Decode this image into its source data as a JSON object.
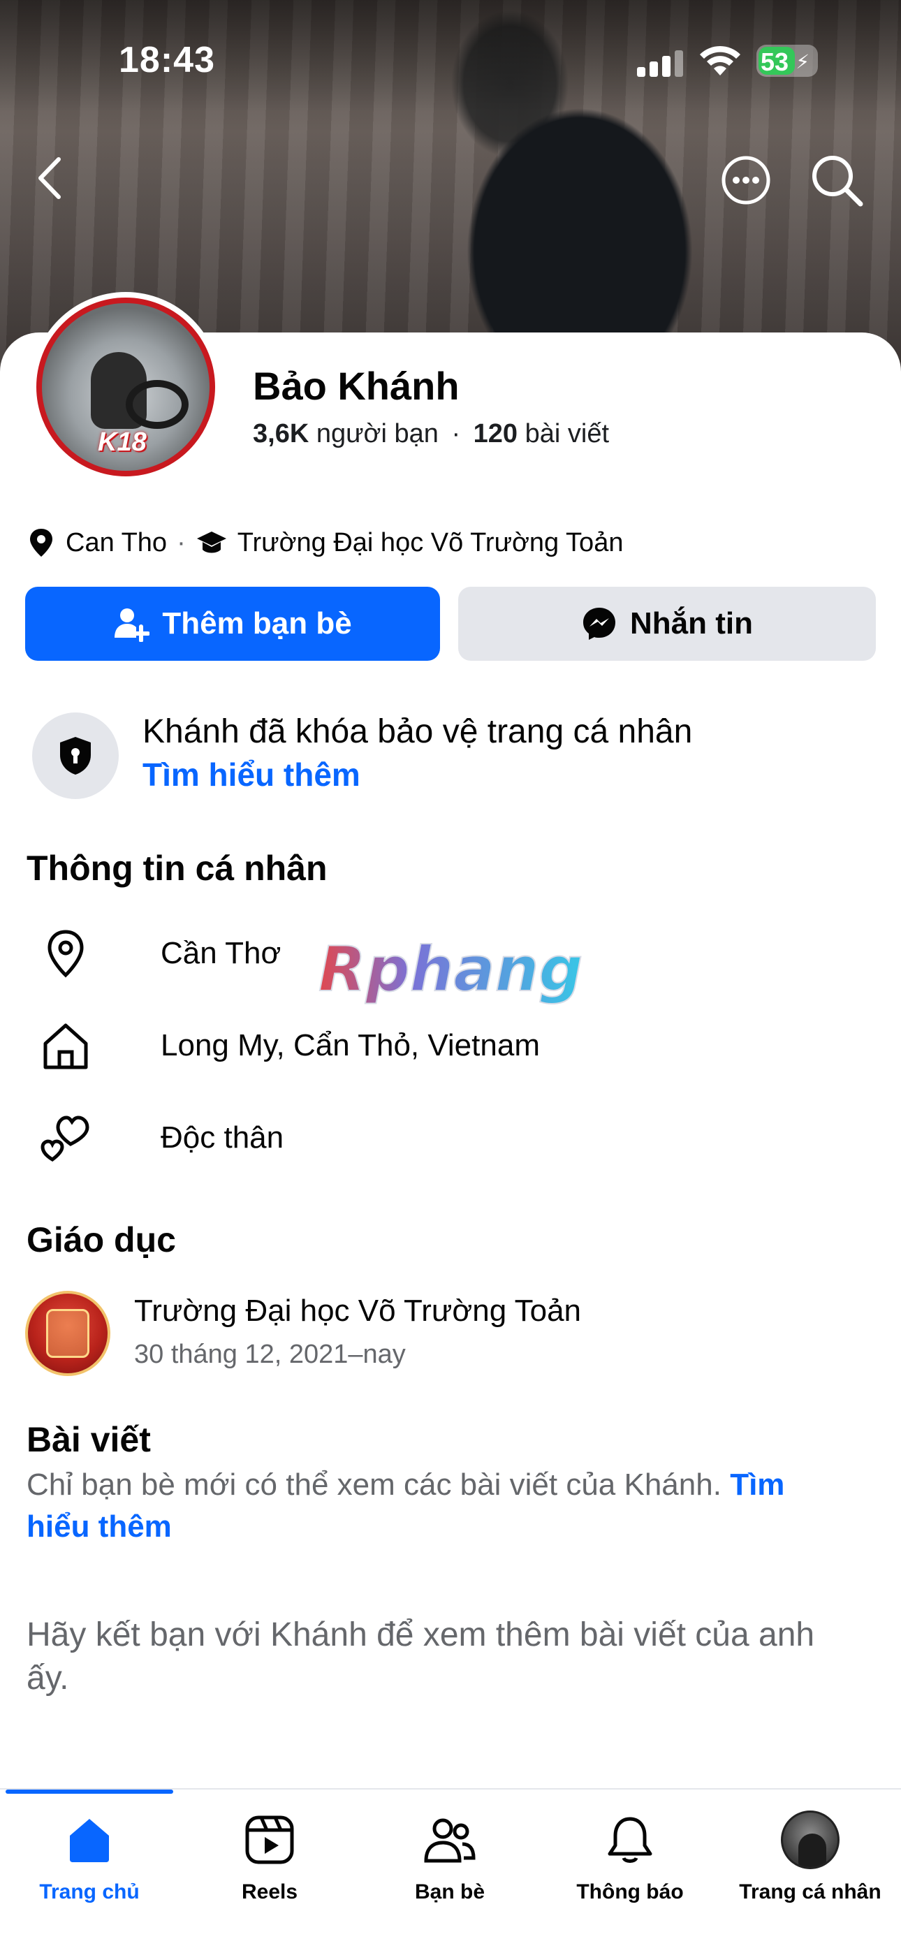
{
  "status_bar": {
    "time": "18:43",
    "battery": "53"
  },
  "profile": {
    "name": "Bảo Khánh",
    "friends_count": "3,6K",
    "friends_label": "người bạn",
    "separator": "·",
    "posts_count": "120",
    "posts_label": "bài viết",
    "avatar_badge": "K18",
    "city": "Can Tho",
    "school": "Trường Đại học Võ Trường Toản"
  },
  "actions": {
    "add_friend": "Thêm bạn bè",
    "message": "Nhắn tin"
  },
  "lock_notice": {
    "title": "Khánh đã khóa bảo vệ trang cá nhân",
    "link": "Tìm hiểu thêm"
  },
  "personal_info": {
    "title": "Thông tin cá nhân",
    "items": [
      {
        "icon": "location-pin-icon",
        "text": "Cần Thơ"
      },
      {
        "icon": "home-icon",
        "text": "Long My, Cẩn Thỏ, Vietnam"
      },
      {
        "icon": "hearts-icon",
        "text": "Độc thân"
      }
    ]
  },
  "watermark": "Rphang",
  "education": {
    "title": "Giáo dục",
    "school": "Trường Đại học Võ Trường Toản",
    "dates": "30 tháng 12, 2021–nay"
  },
  "posts": {
    "title": "Bài viết",
    "note": "Chỉ bạn bè mới có thể xem các bài viết của Khánh.",
    "note_link": "Tìm hiểu thêm",
    "friend_note": "Hãy kết bạn với Khánh để xem thêm bài viết của anh ấy."
  },
  "tabbar": {
    "items": [
      {
        "label": "Trang chủ",
        "icon": "home-icon",
        "active": true
      },
      {
        "label": "Reels",
        "icon": "reels-icon"
      },
      {
        "label": "Bạn bè",
        "icon": "friends-icon"
      },
      {
        "label": "Thông báo",
        "icon": "bell-icon"
      },
      {
        "label": "Trang cá nhân",
        "icon": "profile-avatar"
      }
    ]
  },
  "colors": {
    "accent": "#0866ff",
    "secondary_text": "#65676b",
    "button_gray": "#e4e6eb"
  }
}
